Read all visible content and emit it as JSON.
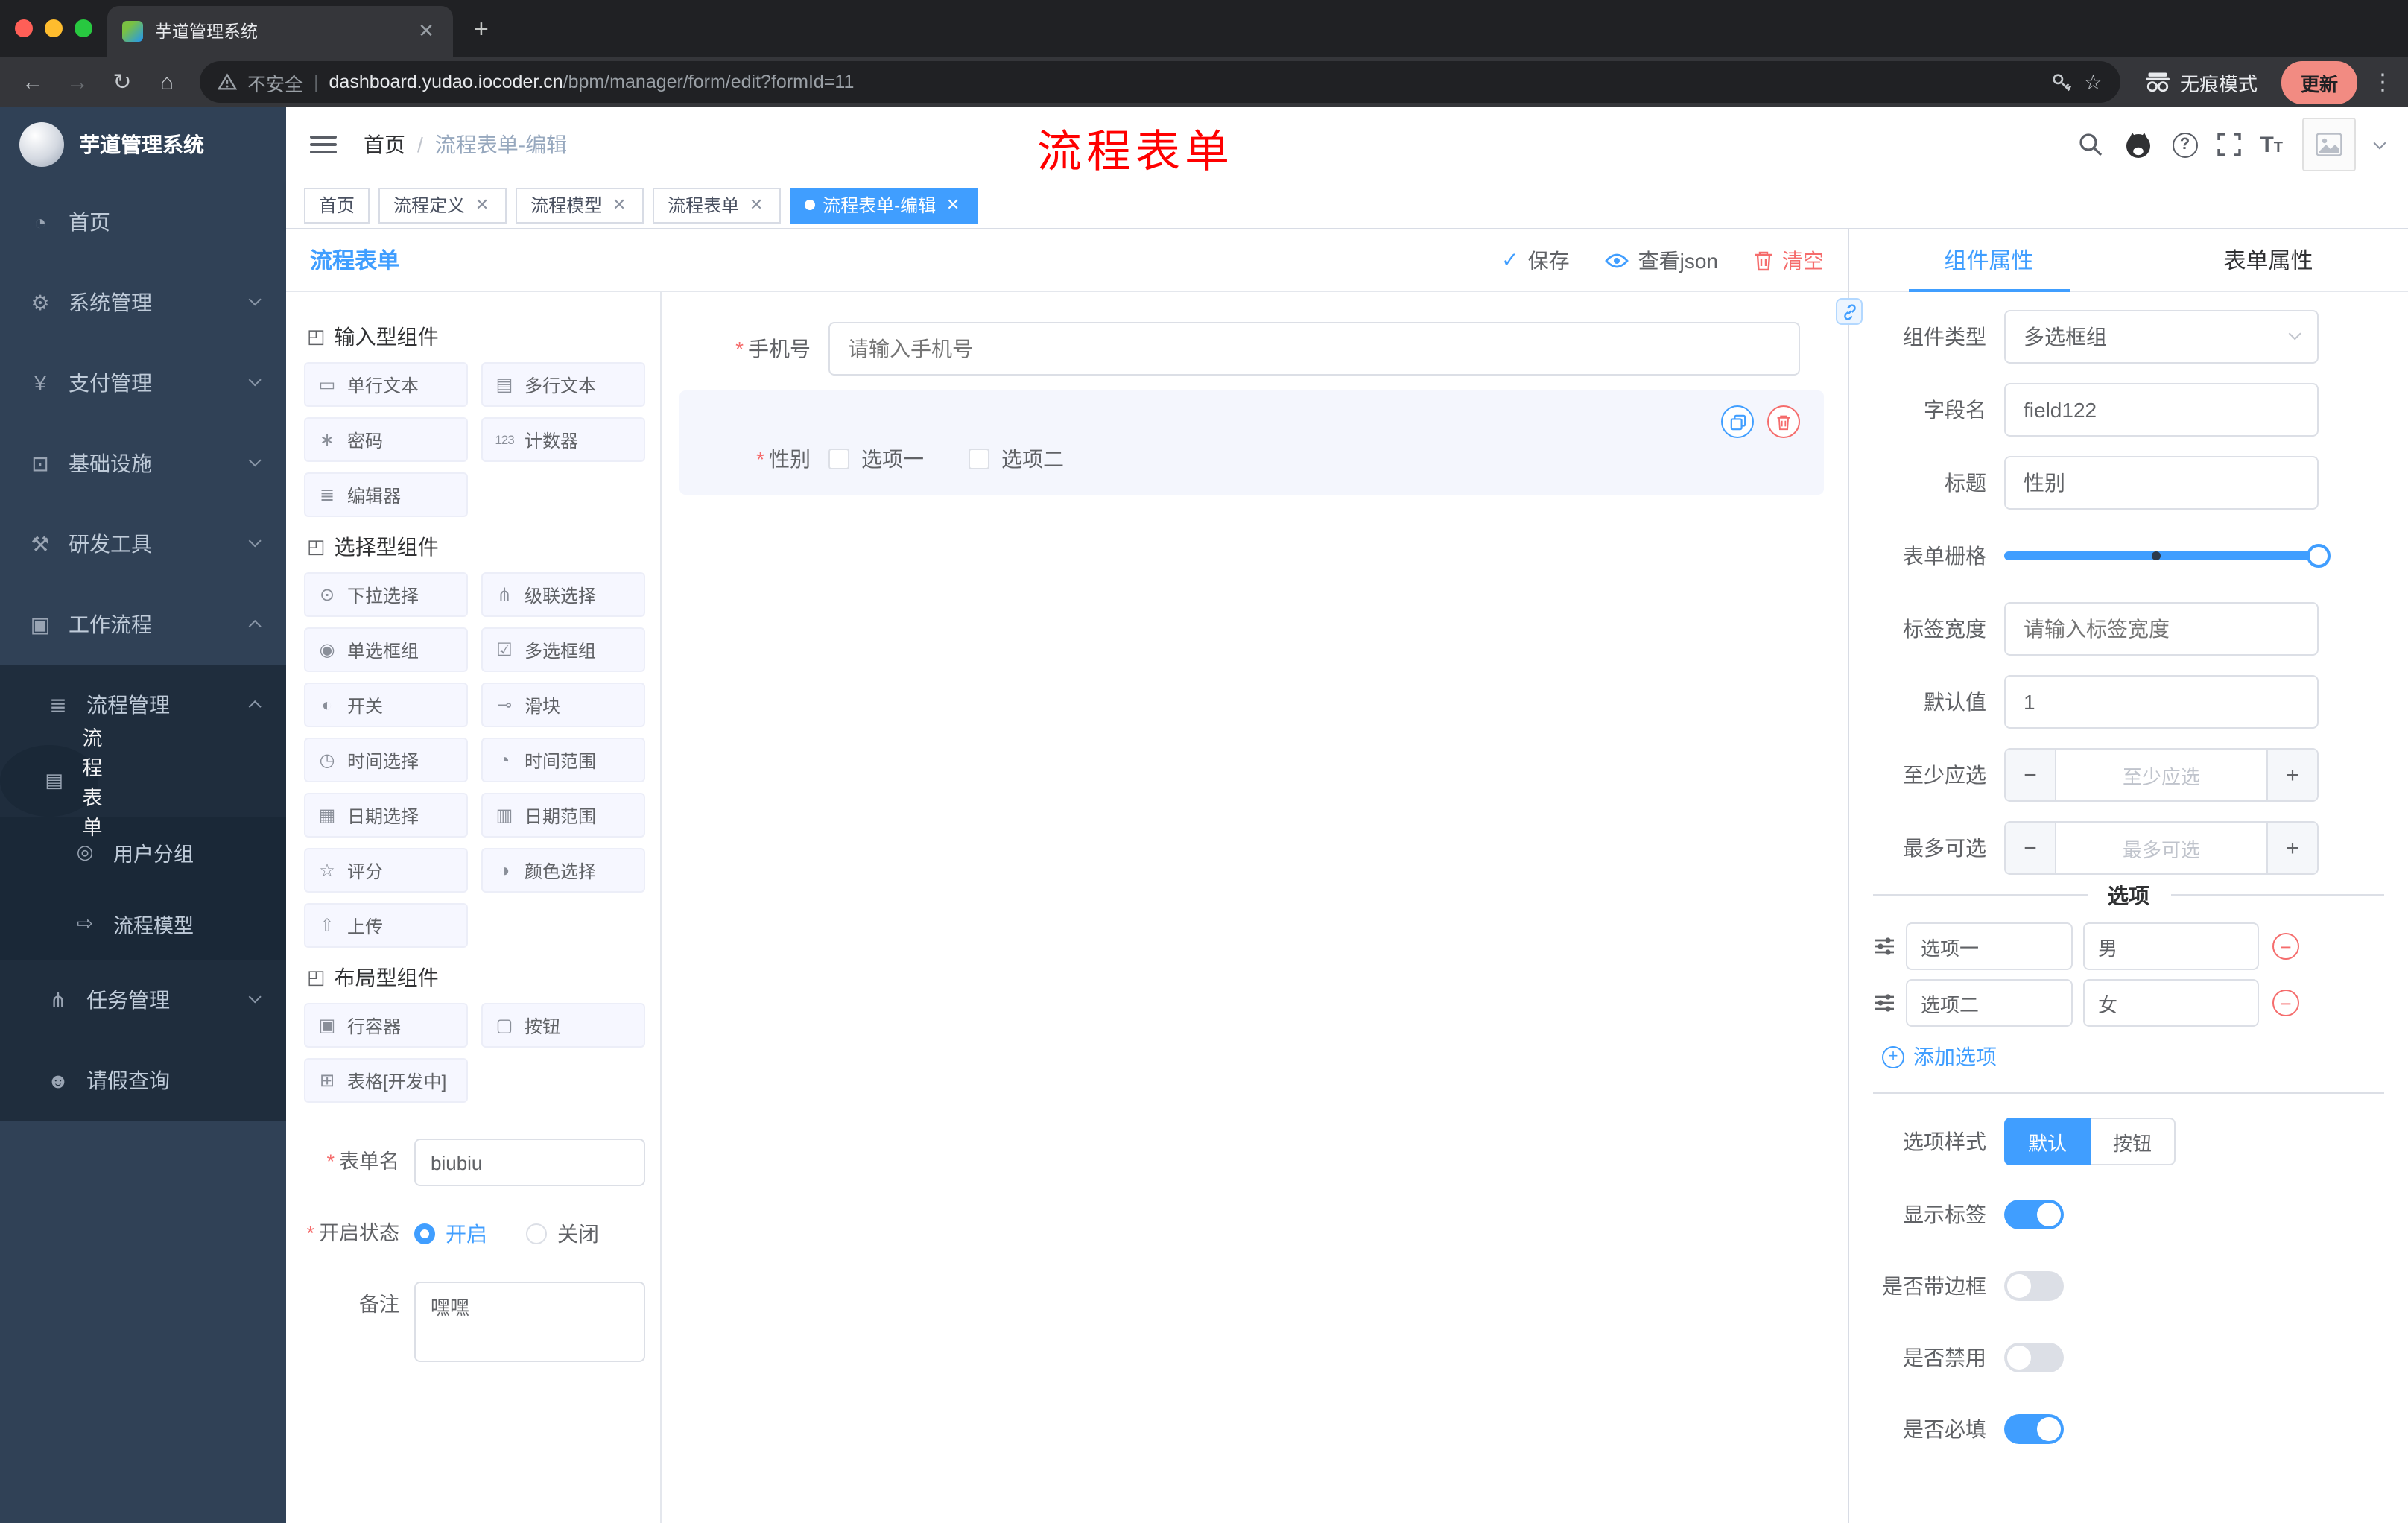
{
  "browser": {
    "tab_title": "芋道管理系统",
    "url_security": "不安全",
    "url_domain": "dashboard.yudao.iocoder.cn",
    "url_path": "/bpm/manager/form/edit?formId=11",
    "incognito_label": "无痕模式",
    "update_label": "更新"
  },
  "sidebar": {
    "title": "芋道管理系统",
    "menu": [
      {
        "label": "首页",
        "glyph": "◔"
      },
      {
        "label": "系统管理",
        "glyph": "⚙"
      },
      {
        "label": "支付管理",
        "glyph": "¥"
      },
      {
        "label": "基础设施",
        "glyph": "⊡"
      },
      {
        "label": "研发工具",
        "glyph": "⚒"
      },
      {
        "label": "工作流程",
        "glyph": "▣"
      }
    ],
    "submenu": [
      {
        "label": "流程管理",
        "glyph": "≣"
      },
      {
        "label": "流程表单",
        "glyph": "▤"
      },
      {
        "label": "用户分组",
        "glyph": "◎"
      },
      {
        "label": "流程模型",
        "glyph": "⇨"
      },
      {
        "label": "任务管理",
        "glyph": "⋔"
      },
      {
        "label": "请假查询",
        "glyph": "☻"
      }
    ]
  },
  "header": {
    "breadcrumb_home": "首页",
    "breadcrumb_current": "流程表单-编辑",
    "annotation": "流程表单"
  },
  "tags": [
    {
      "label": "首页"
    },
    {
      "label": "流程定义"
    },
    {
      "label": "流程模型"
    },
    {
      "label": "流程表单"
    },
    {
      "label": "流程表单-编辑"
    }
  ],
  "designer": {
    "title": "流程表单",
    "actions": {
      "save": "保存",
      "view_json": "查看json",
      "clear": "清空"
    },
    "palette": {
      "groups": [
        {
          "title": "输入型组件",
          "items": [
            {
              "label": "单行文本",
              "glyph": "▭"
            },
            {
              "label": "多行文本",
              "glyph": "▤"
            },
            {
              "label": "密码",
              "glyph": "∗"
            },
            {
              "label": "计数器",
              "glyph": "123"
            },
            {
              "label": "编辑器",
              "glyph": "≣"
            }
          ]
        },
        {
          "title": "选择型组件",
          "items": [
            {
              "label": "下拉选择",
              "glyph": "⊙"
            },
            {
              "label": "级联选择",
              "glyph": "⋔"
            },
            {
              "label": "单选框组",
              "glyph": "◉"
            },
            {
              "label": "多选框组",
              "glyph": "☑"
            },
            {
              "label": "开关",
              "glyph": "◐"
            },
            {
              "label": "滑块",
              "glyph": "⊸"
            },
            {
              "label": "时间选择",
              "glyph": "◷"
            },
            {
              "label": "时间范围",
              "glyph": "◔"
            },
            {
              "label": "日期选择",
              "glyph": "▦"
            },
            {
              "label": "日期范围",
              "glyph": "▥"
            },
            {
              "label": "评分",
              "glyph": "☆"
            },
            {
              "label": "颜色选择",
              "glyph": "◑"
            },
            {
              "label": "上传",
              "glyph": "⇧"
            }
          ]
        },
        {
          "title": "布局型组件",
          "items": [
            {
              "label": "行容器",
              "glyph": "▣"
            },
            {
              "label": "按钮",
              "glyph": "▢"
            },
            {
              "label": "表格[开发中]",
              "glyph": "⊞"
            }
          ]
        }
      ]
    },
    "meta": {
      "name_label": "表单名",
      "name_value": "biubiu",
      "status_label": "开启状态",
      "status_on": "开启",
      "status_off": "关闭",
      "remark_label": "备注",
      "remark_value": "嘿嘿"
    },
    "canvas": {
      "phone_label": "手机号",
      "phone_placeholder": "请输入手机号",
      "gender_label": "性别",
      "gender_option1": "选项一",
      "gender_option2": "选项二"
    }
  },
  "props": {
    "tab_component": "组件属性",
    "tab_form": "表单属性",
    "component_type_label": "组件类型",
    "component_type_value": "多选框组",
    "field_name_label": "字段名",
    "field_name_value": "field122",
    "title_label": "标题",
    "title_value": "性别",
    "grid_label": "表单栅格",
    "tag_width_label": "标签宽度",
    "tag_width_placeholder": "请输入标签宽度",
    "default_label": "默认值",
    "default_value": "1",
    "min_label": "至少应选",
    "min_placeholder": "至少应选",
    "max_label": "最多可选",
    "max_placeholder": "最多可选",
    "options_title": "选项",
    "options": [
      {
        "label": "选项一",
        "value": "男"
      },
      {
        "label": "选项二",
        "value": "女"
      }
    ],
    "add_option": "添加选项",
    "style_label": "选项样式",
    "style_default": "默认",
    "style_button": "按钮",
    "toggle_show_label": "显示标签",
    "toggle_border": "是否带边框",
    "toggle_disabled": "是否禁用",
    "toggle_required": "是否必填"
  },
  "colors": {
    "accent": "#409eff",
    "danger": "#f56c6c",
    "sidebar": "#304156"
  }
}
